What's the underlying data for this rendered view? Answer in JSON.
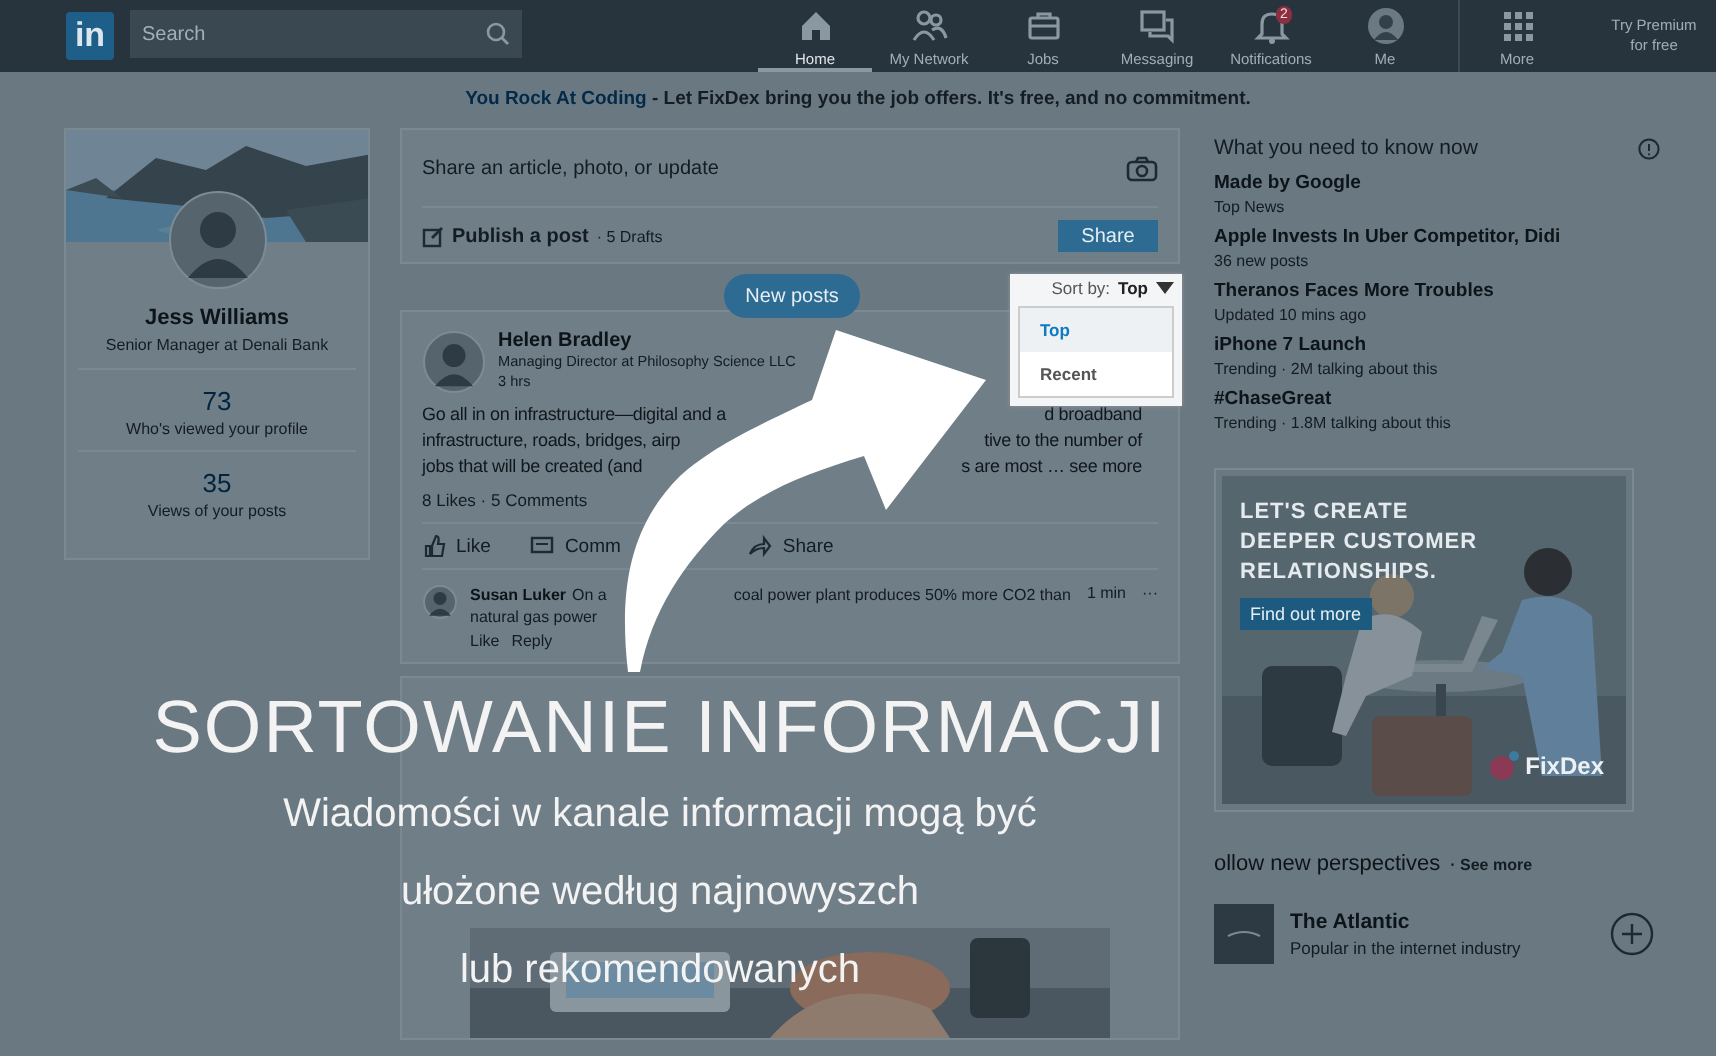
{
  "nav": {
    "logo": "in",
    "search": {
      "placeholder": "Search"
    },
    "items": [
      {
        "label": "Home",
        "kind": "home",
        "selected": true
      },
      {
        "label": "My Network",
        "kind": "people",
        "selected": false
      },
      {
        "label": "Jobs",
        "kind": "briefcase",
        "selected": false
      },
      {
        "label": "Messaging",
        "kind": "chat",
        "selected": false
      },
      {
        "label": "Notifications",
        "kind": "bell",
        "selected": false,
        "badge": "2"
      },
      {
        "label": "Me",
        "kind": "avatar",
        "selected": false
      },
      {
        "label": "More",
        "kind": "grid",
        "selected": false
      }
    ],
    "premium": "Try Premium for free"
  },
  "banner": {
    "link": "You Rock At Coding",
    "text": " - Let FixDex bring you the job offers. It's free, and no commitment."
  },
  "profile": {
    "name": "Jess Williams",
    "headline": "Senior Manager at Denali Bank",
    "stats": [
      {
        "value": "73",
        "label": "Who's viewed your profile"
      },
      {
        "value": "35",
        "label": "Views of your posts"
      }
    ]
  },
  "share": {
    "placeholder": "Share an article, photo, or update",
    "publish": "Publish a post",
    "drafts": "· 5 Drafts",
    "button": "Share"
  },
  "new_posts": "New posts",
  "sort": {
    "label": "Sort by:",
    "value": "Top",
    "options": [
      {
        "label": "Top",
        "selected": true
      },
      {
        "label": "Recent",
        "selected": false
      }
    ]
  },
  "post": {
    "author": "Helen Bradley",
    "headline": "Managing Director at Philosophy Science LLC",
    "time": "3 hrs",
    "body_lines": [
      {
        "left": "Go all in on infrastructure—digital and a",
        "right": "d broadband"
      },
      {
        "left": "infrastructure, roads, bridges, airp",
        "right": "tive to the number of"
      },
      {
        "left": "jobs that will be created (and",
        "right": "s are most … see more"
      }
    ],
    "stats": "8 Likes · 5 Comments",
    "actions": [
      {
        "label": "Like",
        "kind": "thumb"
      },
      {
        "label": "Comm",
        "kind": "comment"
      },
      {
        "label": "Share",
        "kind": "share"
      }
    ],
    "comment": {
      "author": "Susan Luker",
      "lines": [
        {
          "left": "On a",
          "right": "coal power plant produces 50% more CO2 than"
        },
        {
          "left": "natural gas power"
        }
      ],
      "time": "1 min",
      "menu": "···",
      "actions": [
        "Like",
        "Reply"
      ]
    }
  },
  "news": {
    "heading": "What you need to know now",
    "items": [
      {
        "title": "Made by Google",
        "sub": "Top News"
      },
      {
        "title": "Apple Invests In Uber Competitor, Didi",
        "sub": "36 new posts"
      },
      {
        "title": "Theranos Faces More Troubles",
        "sub": "Updated 10 mins ago"
      },
      {
        "title": "iPhone 7 Launch",
        "sub": "Trending · 2M talking about this"
      },
      {
        "title": "#ChaseGreat",
        "sub": "Trending · 1.8M talking about this"
      }
    ]
  },
  "ad": {
    "headline": "LET'S CREATE DEEPER CUSTOMER RELATIONSHIPS.",
    "button": "Find out more",
    "brand": "FixDex"
  },
  "follow": {
    "heading": "ollow new perspectives",
    "more": "· See more",
    "items": [
      {
        "name": "The Atlantic",
        "sub": "Popular in the internet industry"
      }
    ]
  },
  "caption": {
    "title": "SORTOWANIE INFORMACJI",
    "lines": [
      "Wiadomości w kanale informacji mogą być",
      "ułożone według najnowyszch",
      "lub rekomendowanych"
    ]
  }
}
